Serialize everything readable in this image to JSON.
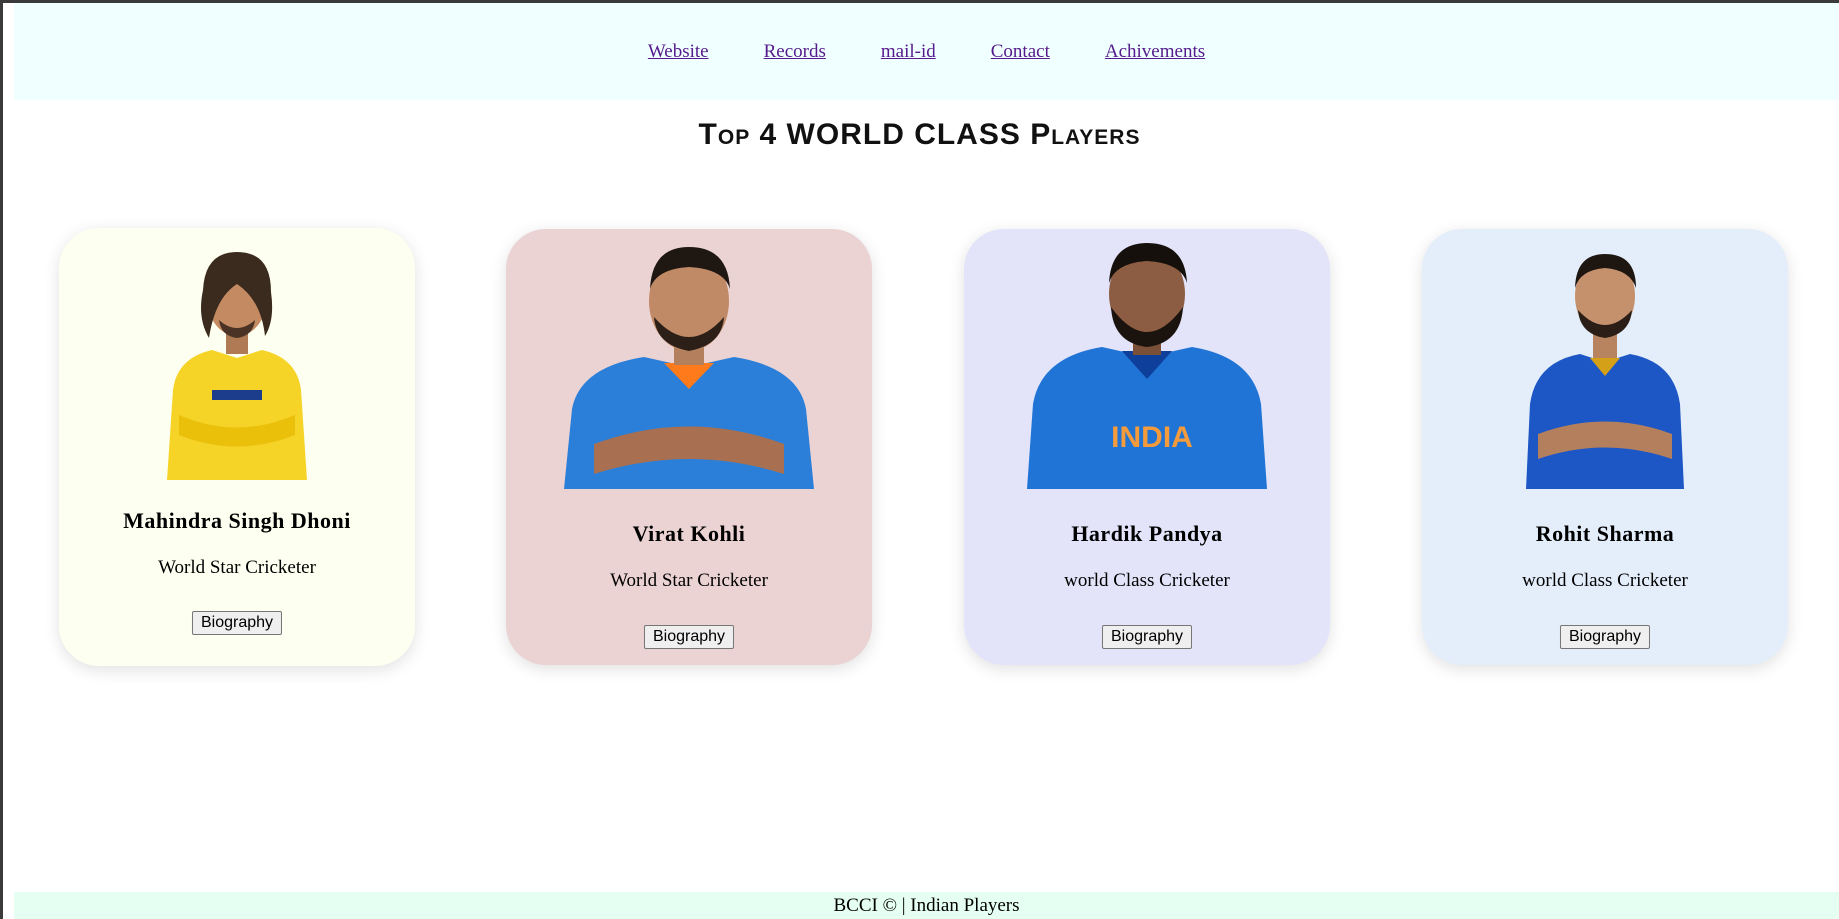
{
  "nav": {
    "links": [
      "Website",
      "Records",
      "mail-id",
      "Contact",
      "Achivements"
    ]
  },
  "heading": "Top 4 WORLD CLASS Players",
  "players": [
    {
      "name": "Mahindra Singh Dhoni",
      "role": "World Star Cricketer",
      "button": "Biography",
      "card_color": "#fdfff0",
      "jersey_color": "#f5d327",
      "jersey_accent": "#1c3c8c"
    },
    {
      "name": "Virat Kohli",
      "role": "World Star Cricketer",
      "button": "Biography",
      "card_color": "#ebd2d3",
      "jersey_color": "#2b7fd8",
      "jersey_accent": "#ff7a1a"
    },
    {
      "name": "Hardik Pandya",
      "role": "world Class Cricketer",
      "button": "Biography",
      "card_color": "#e3e3f9",
      "jersey_color": "#1f74d6",
      "jersey_accent": "#f59b3c"
    },
    {
      "name": "Rohit Sharma",
      "role": "world Class Cricketer",
      "button": "Biography",
      "card_color": "#e4eefb",
      "jersey_color": "#1d57c6",
      "jersey_accent": "#d4a017"
    }
  ],
  "footer": "BCCI © | Indian Players"
}
